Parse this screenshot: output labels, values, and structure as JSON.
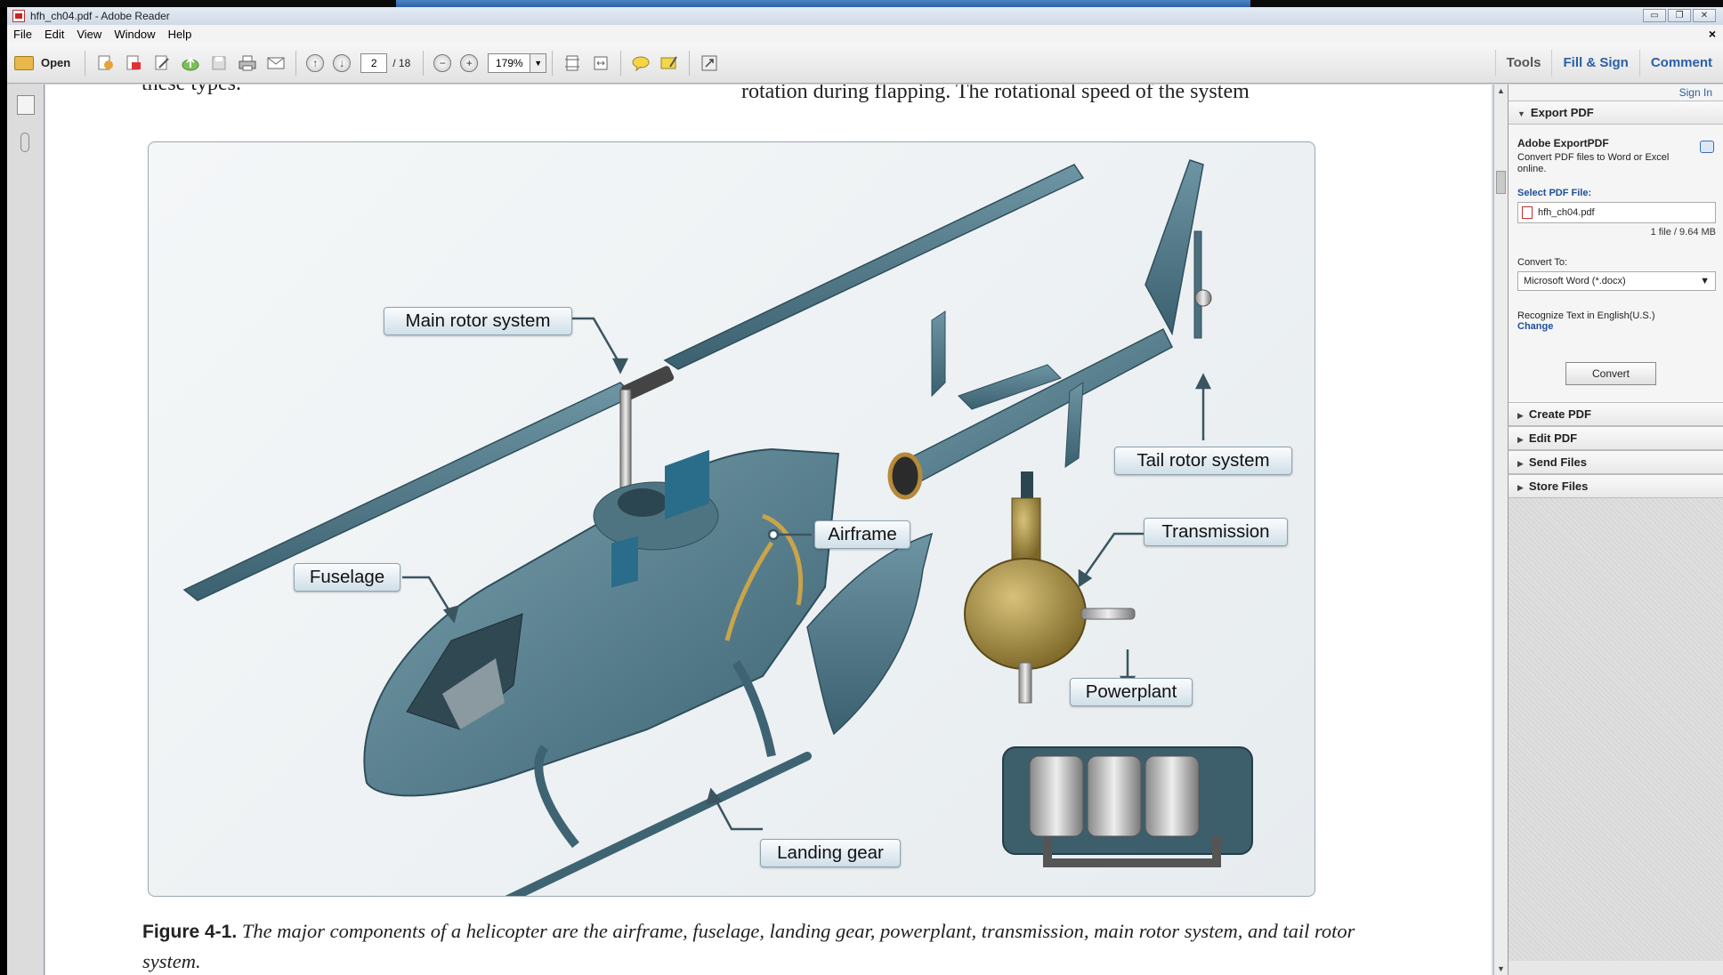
{
  "window": {
    "title": "hfh_ch04.pdf - Adobe Reader",
    "minimize": "▭",
    "restore": "❐",
    "close": "✕"
  },
  "menu": {
    "items": [
      "File",
      "Edit",
      "View",
      "Window",
      "Help"
    ],
    "close_x": "×"
  },
  "toolbar": {
    "open_label": "Open",
    "current_page": "2",
    "total_pages": "/ 18",
    "zoom": "179%",
    "right_links": {
      "tools": "Tools",
      "fill_sign": "Fill & Sign",
      "comment": "Comment"
    }
  },
  "panel": {
    "sign_in": "Sign In",
    "export": {
      "header": "Export PDF",
      "title": "Adobe ExportPDF",
      "description": "Convert PDF files to Word or Excel online.",
      "select_label": "Select PDF File:",
      "file_name": "hfh_ch04.pdf",
      "file_info": "1 file / 9.64 MB",
      "convert_to_label": "Convert To:",
      "convert_to_value": "Microsoft Word (*.docx)",
      "recognize_text": "Recognize Text in English(U.S.)",
      "change_link": "Change",
      "convert_button": "Convert"
    },
    "sections": [
      "Create PDF",
      "Edit PDF",
      "Send Files",
      "Store Files"
    ]
  },
  "document": {
    "text_top_left": "these types.",
    "text_top_right": "rotation during flapping. The rotational speed of the system",
    "figure_labels": {
      "main_rotor": "Main rotor system",
      "tail_rotor": "Tail rotor system",
      "airframe": "Airframe",
      "transmission": "Transmission",
      "fuselage": "Fuselage",
      "powerplant": "Powerplant",
      "landing_gear": "Landing gear"
    },
    "caption_label": "Figure 4-1.",
    "caption_text": " The major components of a helicopter are the airframe, fuselage, landing gear, powerplant, transmission, main rotor system, and tail rotor system."
  },
  "colors": {
    "accent": "#2a5fa6",
    "helicopter_body": "#4f7888",
    "frame_brass": "#c9a44a"
  }
}
